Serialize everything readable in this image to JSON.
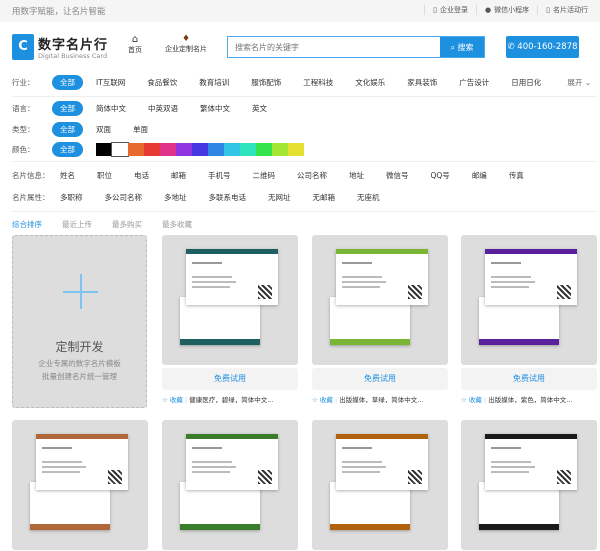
{
  "topbar": {
    "slogan": "用数字赋能，让名片智能",
    "links": [
      "企业登录",
      "微信小程序",
      "名片活动行"
    ]
  },
  "header": {
    "logo_letter": "C",
    "brand": "数字名片行",
    "brand_sub": "Digital Business Card",
    "nav": [
      "首页",
      "企业定制名片"
    ],
    "search_placeholder": "搜索名片的关键字",
    "search_button": "搜索",
    "phone": "400-160-2878"
  },
  "filters": {
    "industry": {
      "label": "行业：",
      "all": "全部",
      "options": [
        "IT互联网",
        "食品餐饮",
        "教育培训",
        "服饰配饰",
        "工程科技",
        "文化娱乐",
        "家具装饰",
        "广告设计",
        "日用日化"
      ],
      "expand": "展开"
    },
    "language": {
      "label": "语言：",
      "all": "全部",
      "options": [
        "简体中文",
        "中英双语",
        "繁体中文",
        "英文"
      ]
    },
    "type": {
      "label": "类型：",
      "all": "全部",
      "options": [
        "双面",
        "单面"
      ]
    },
    "color": {
      "label": "颜色：",
      "all": "全部",
      "swatches": [
        "#000000",
        "#ffffff",
        "#e8692d",
        "#e73a33",
        "#e0338a",
        "#8e35e0",
        "#4637e0",
        "#2f86e3",
        "#32c5e6",
        "#2ee4bf",
        "#34e44a",
        "#a3e633",
        "#e5e133"
      ]
    },
    "info": {
      "label": "名片信息：",
      "options": [
        "姓名",
        "职位",
        "电话",
        "邮箱",
        "手机号",
        "二维码",
        "公司名称",
        "地址",
        "微信号",
        "QQ号",
        "邮编",
        "传真"
      ]
    },
    "attr": {
      "label": "名片属性：",
      "options": [
        "多职称",
        "多公司名称",
        "多地址",
        "多联系电话",
        "无网址",
        "无邮箱",
        "无座机"
      ]
    }
  },
  "sort": [
    "综合排序",
    "最近上传",
    "最多购买",
    "最多收藏"
  ],
  "custom": {
    "title": "定制开发",
    "line1": "企业专属的数字名片模板",
    "line2": "批量创建名片统一管理"
  },
  "cards": [
    {
      "try": "免费试用",
      "fav": "收藏",
      "tags": "健康医疗，碧绿，简体中文...",
      "accent": "#1e5f60"
    },
    {
      "try": "免费试用",
      "fav": "收藏",
      "tags": "出版媒体，草绿，简体中文...",
      "accent": "#7ab535"
    },
    {
      "try": "免费试用",
      "fav": "收藏",
      "tags": "出版媒体，紫色，简体中文...",
      "accent": "#5a1f9a"
    },
    {
      "accent": "#b0683a"
    },
    {
      "accent": "#3a7d2a"
    },
    {
      "accent": "#b0620e"
    },
    {
      "accent": "#1a1a1a"
    }
  ]
}
